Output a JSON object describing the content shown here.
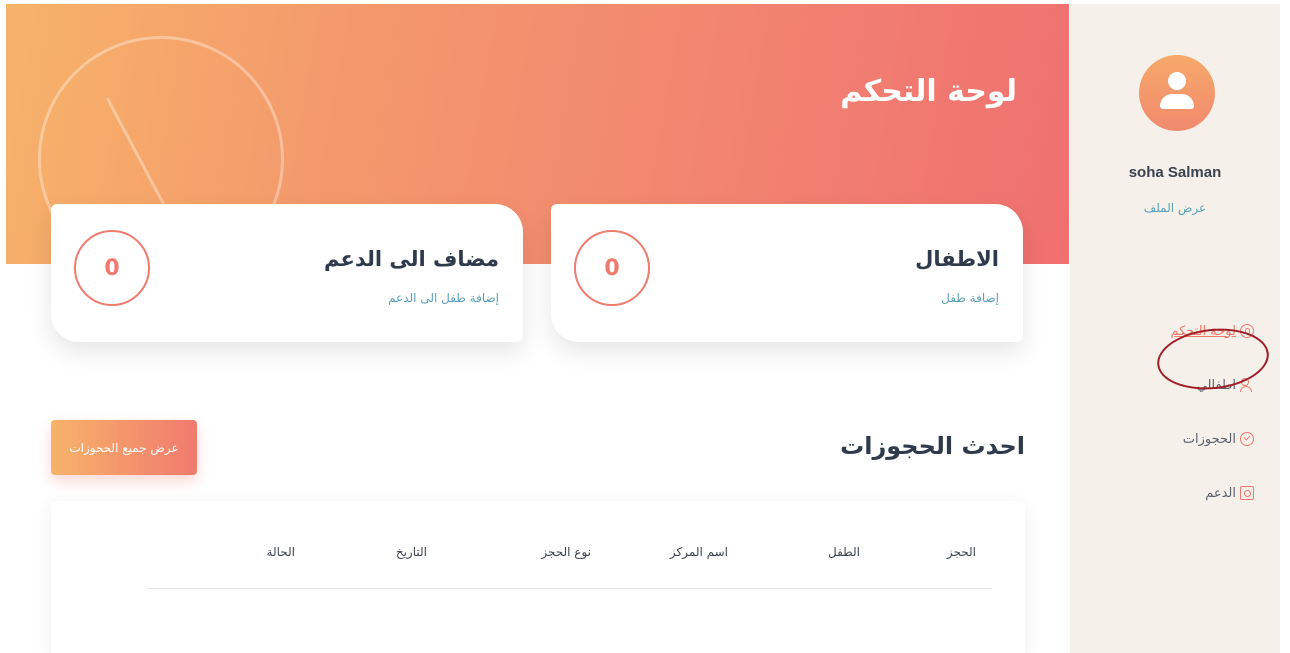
{
  "header": {
    "title": "لوحة التحكم"
  },
  "sidebar": {
    "user_name": "soha Salman",
    "view_profile": "عرض الملف",
    "items": [
      {
        "label": "لوحة التحكم",
        "icon": "dashboard-icon",
        "active": true
      },
      {
        "label": "اطفالي",
        "icon": "children-icon",
        "active": false
      },
      {
        "label": "الحجوزات",
        "icon": "check-circle-icon",
        "active": false
      },
      {
        "label": "الدعم",
        "icon": "support-icon",
        "active": false
      }
    ]
  },
  "cards": {
    "kids": {
      "title": "الاطفال",
      "link": "إضافة طفل",
      "count": "0"
    },
    "support": {
      "title": "مضاف الى الدعم",
      "link": "إضافة طفل الى الدعم",
      "count": "0"
    }
  },
  "bookings": {
    "title": "احدث الحجوزات",
    "view_all": "عرض جميع الحجوزات",
    "columns": [
      "الحجز",
      "الطفل",
      "اسم المركز",
      "نوع الحجز",
      "التاريخ",
      "الحالة"
    ],
    "rows": []
  },
  "colors": {
    "accent": "#f07a6e",
    "accent_light": "#f7b36a",
    "sidebar_bg": "#f5f0ea",
    "link": "#5aa0b8",
    "annotation": "#a01d26"
  }
}
